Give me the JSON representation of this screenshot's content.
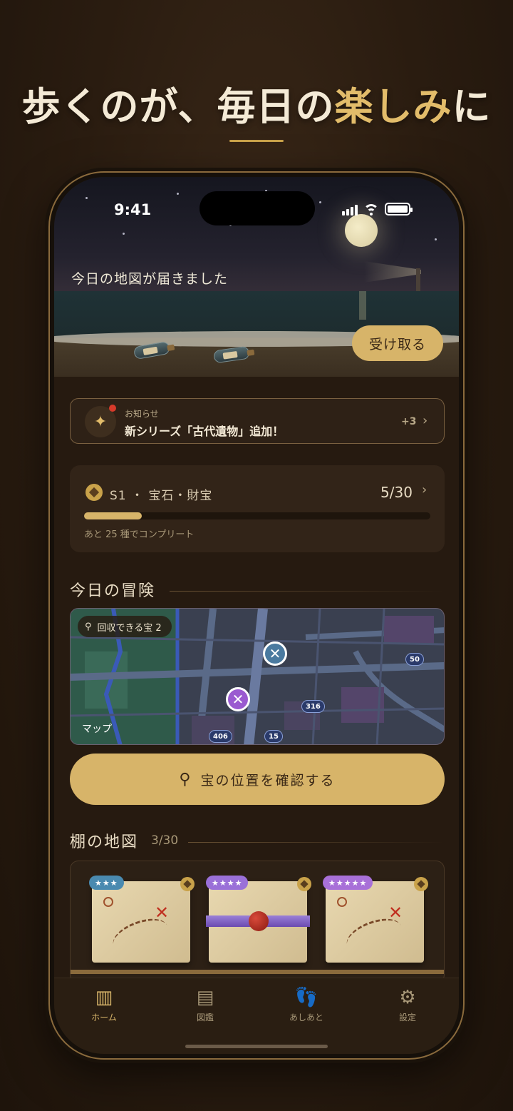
{
  "headline": {
    "part1": "歩くのが、毎日の",
    "accent": "楽しみ",
    "part2": "に"
  },
  "status": {
    "time": "9:41"
  },
  "hero": {
    "message": "今日の地図が届きました",
    "receive_label": "受け取る"
  },
  "notice": {
    "label": "お知らせ",
    "title": "新シリーズ「古代遺物」追加！",
    "count": "+3",
    "icon": "sparkle-icon"
  },
  "series": {
    "name": "S1 ・ 宝石・財宝",
    "count": "5/30",
    "progress": 0.1667,
    "remaining": "あと 25 種でコンプリート"
  },
  "adventure": {
    "title": "今日の冒険",
    "badge": "回収できる宝 2",
    "maps_label": "マップ",
    "route_shields": [
      "50",
      "316",
      "406",
      "15"
    ],
    "markers": [
      {
        "color": "#4a7aa0"
      },
      {
        "color": "#9a5ad0"
      }
    ],
    "confirm_label": "宝の位置を確認する"
  },
  "shelf": {
    "title": "棚の地図",
    "count": "3/30",
    "cards": [
      {
        "stars": "★★★",
        "rank_color": "#4a8ab0"
      },
      {
        "stars": "★★★★",
        "rank_color": "#9a70d8"
      },
      {
        "stars": "★★★★★",
        "rank_color": "#a870d8"
      }
    ]
  },
  "tabs": [
    {
      "label": "ホーム",
      "icon": "map-icon",
      "glyph": "▥",
      "active": true
    },
    {
      "label": "図鑑",
      "icon": "book-icon",
      "glyph": "▤",
      "active": false
    },
    {
      "label": "あしあと",
      "icon": "footprints-icon",
      "glyph": "👣",
      "active": false
    },
    {
      "label": "設定",
      "icon": "gear-icon",
      "glyph": "⚙",
      "active": false
    }
  ]
}
